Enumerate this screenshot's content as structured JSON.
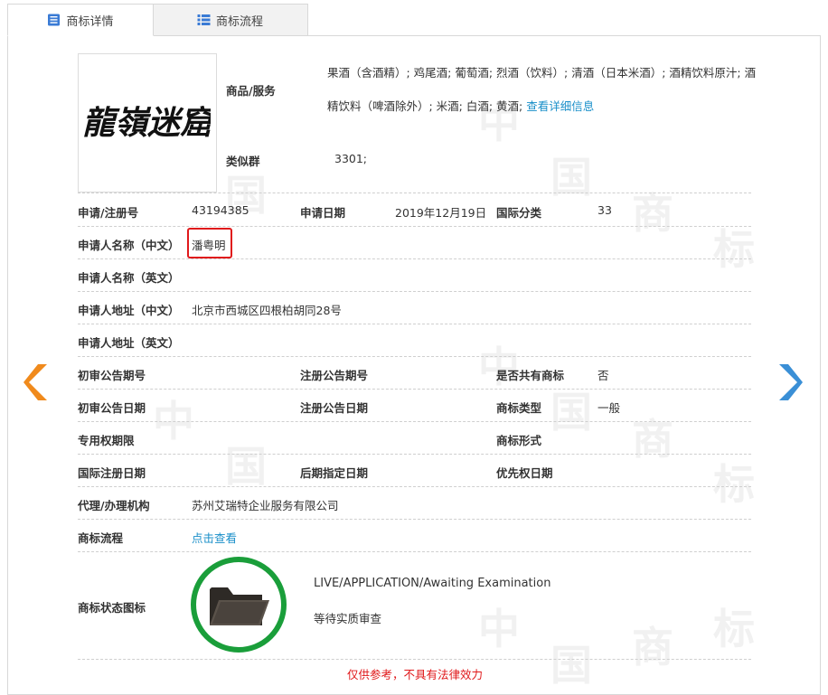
{
  "tabs": [
    {
      "label": "商标详情",
      "icon": "document-icon"
    },
    {
      "label": "商标流程",
      "icon": "list-icon"
    }
  ],
  "logo_text": "龍嶺迷窟",
  "goods": {
    "label": "商品/服务",
    "text": "果酒（含酒精）; 鸡尾酒; 葡萄酒; 烈酒（饮料）; 清酒（日本米酒）; 酒精饮料原汁; 酒精饮料（啤酒除外）; 米酒; 白酒; 黄酒;",
    "link": "查看详细信息"
  },
  "similar_group": {
    "label": "类似群",
    "value": "3301;"
  },
  "reg_no": {
    "label": "申请/注册号",
    "value": "43194385"
  },
  "app_date": {
    "label": "申请日期",
    "value": "2019年12月19日"
  },
  "intl_class": {
    "label": "国际分类",
    "value": "33"
  },
  "applicant_cn": {
    "label": "申请人名称（中文）",
    "value": "潘粤明"
  },
  "applicant_en": {
    "label": "申请人名称（英文）",
    "value": ""
  },
  "address_cn": {
    "label": "申请人地址（中文）",
    "value": "北京市西城区四根柏胡同28号"
  },
  "address_en": {
    "label": "申请人地址（英文）",
    "value": ""
  },
  "prelim_no": {
    "label": "初审公告期号",
    "value": ""
  },
  "reg_pub_no": {
    "label": "注册公告期号",
    "value": ""
  },
  "shared": {
    "label": "是否共有商标",
    "value": "否"
  },
  "prelim_date": {
    "label": "初审公告日期",
    "value": ""
  },
  "reg_pub_date": {
    "label": "注册公告日期",
    "value": ""
  },
  "mark_type": {
    "label": "商标类型",
    "value": "一般"
  },
  "exclusive_period": {
    "label": "专用权期限",
    "value": ""
  },
  "mark_form": {
    "label": "商标形式",
    "value": ""
  },
  "intl_reg_date": {
    "label": "国际注册日期",
    "value": ""
  },
  "later_date": {
    "label": "后期指定日期",
    "value": ""
  },
  "priority_date": {
    "label": "优先权日期",
    "value": ""
  },
  "agent": {
    "label": "代理/办理机构",
    "value": "苏州艾瑞特企业服务有限公司"
  },
  "process": {
    "label": "商标流程",
    "link": "点击查看"
  },
  "status": {
    "label": "商标状态图标",
    "en": "LIVE/APPLICATION/Awaiting Examination",
    "cn": "等待实质审查",
    "icon": "folder-icon",
    "ring_color": "#1a9e3a"
  },
  "disclaimer": "仅供参考，不具有法律效力",
  "watermark_chars": [
    "中",
    "国",
    "商",
    "标"
  ],
  "nav": {
    "prev_icon": "arrow-left-icon",
    "next_icon": "arrow-right-icon",
    "prev_color": "#f08a1c",
    "next_color": "#3a8fd6"
  }
}
